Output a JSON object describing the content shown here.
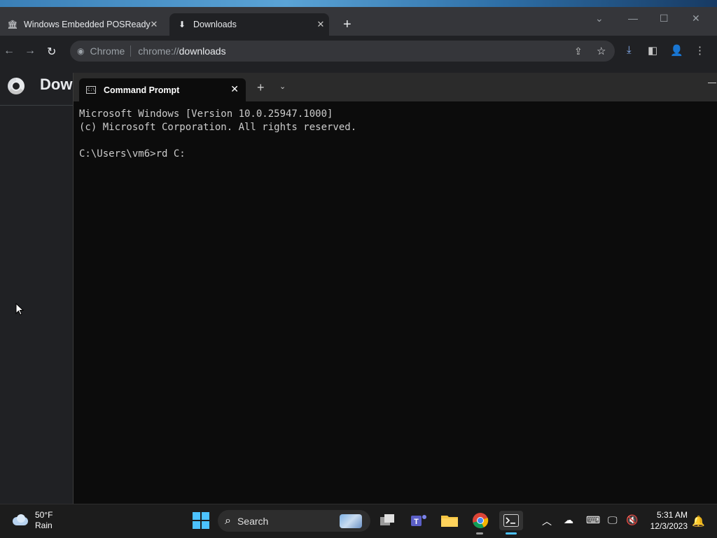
{
  "browser": {
    "tabs": [
      {
        "title": "Windows Embedded POSReady",
        "icon": "building-icon"
      },
      {
        "title": "Downloads",
        "icon": "download-icon",
        "active": true
      }
    ],
    "new_tab_label": "+",
    "omnibox": {
      "site_chip": "Chrome",
      "url_prefix": "chrome://",
      "url_host": "downloads"
    },
    "page_title": "Dow"
  },
  "terminal": {
    "tab_title": "Command Prompt",
    "lines": [
      "Microsoft Windows [Version 10.0.25947.1000]",
      "(c) Microsoft Corporation. All rights reserved.",
      "",
      "C:\\Users\\vm6>rd C:"
    ]
  },
  "taskbar": {
    "weather": {
      "temp": "50°F",
      "condition": "Rain"
    },
    "search_label": "Search",
    "clock": {
      "time": "5:31 AM",
      "date": "12/3/2023"
    }
  },
  "colors": {
    "accent": "#4cc2ff",
    "terminal_bg": "#0c0c0c",
    "chrome_bg": "#202124"
  }
}
